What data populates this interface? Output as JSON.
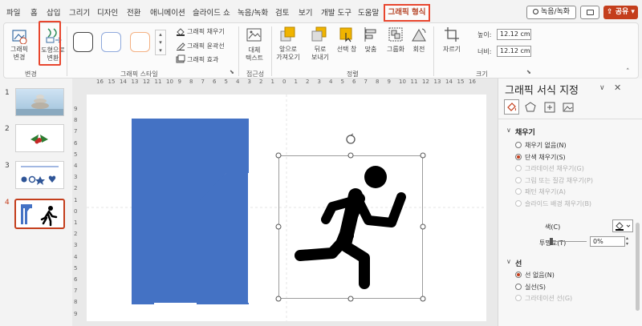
{
  "menu": {
    "items": [
      "파일",
      "홈",
      "삽입",
      "그리기",
      "디자인",
      "전환",
      "애니메이션",
      "슬라이드 쇼",
      "녹음/녹화",
      "검토",
      "보기",
      "개발 도구",
      "도움말"
    ],
    "active_tab": "그래픽 형식",
    "record_button": "녹음/녹화",
    "share_button": "공유"
  },
  "ribbon": {
    "change_graphic": "그래픽\n변경",
    "convert_shape_1": "도형으로",
    "convert_shape_2": "변환",
    "group_change": "변경",
    "graphic_fill": "그래픽 채우기",
    "graphic_outline": "그래픽 윤곽선",
    "graphic_effects": "그래픽 효과",
    "group_styles": "그래픽 스타일",
    "alt_text_1": "대체",
    "alt_text_2": "텍스트",
    "group_accessibility": "접근성",
    "bring_forward_1": "앞으로",
    "bring_forward_2": "가져오기",
    "send_backward_1": "뒤로",
    "send_backward_2": "보내기",
    "selection_pane": "선택 창",
    "align": "맞춤",
    "group": "그룹화",
    "rotate": "회전",
    "group_arrange": "정렬",
    "crop": "자르기",
    "height_label": "높이:",
    "height_value": "12.12 cm",
    "width_label": "너비:",
    "width_value": "12.12 cm",
    "group_size": "크기"
  },
  "slides": [
    {
      "number": "1",
      "desc": "stones"
    },
    {
      "number": "2",
      "desc": "holly"
    },
    {
      "number": "3",
      "desc": "shapes"
    },
    {
      "number": "4",
      "desc": "runner"
    }
  ],
  "ruler": {
    "h_ticks": [
      "16",
      "15",
      "14",
      "13",
      "12",
      "11",
      "10",
      "9",
      "8",
      "7",
      "6",
      "5",
      "4",
      "3",
      "2",
      "1",
      "0",
      "1",
      "2",
      "3",
      "4",
      "5",
      "6",
      "7",
      "8",
      "9",
      "10",
      "11",
      "12",
      "13",
      "14",
      "15",
      "16"
    ],
    "v_ticks": [
      "9",
      "8",
      "7",
      "6",
      "5",
      "4",
      "3",
      "2",
      "1",
      "0",
      "1",
      "2",
      "3",
      "4",
      "5",
      "6",
      "7",
      "8",
      "9"
    ]
  },
  "panel": {
    "title": "그래픽 서식 지정",
    "fill_section": "채우기",
    "fill_options": [
      {
        "label": "채우기 없음(N)",
        "selected": false,
        "disabled": false
      },
      {
        "label": "단색 채우기(S)",
        "selected": true,
        "disabled": false
      },
      {
        "label": "그라데이션 채우기(G)",
        "selected": false,
        "disabled": true
      },
      {
        "label": "그림 또는 질감 채우기(P)",
        "selected": false,
        "disabled": true
      },
      {
        "label": "패턴 채우기(A)",
        "selected": false,
        "disabled": true
      },
      {
        "label": "슬라이드 배경 채우기(B)",
        "selected": false,
        "disabled": true
      }
    ],
    "color_label": "색(C)",
    "transparency_label": "투명도(T)",
    "transparency_value": "0%",
    "line_section": "선",
    "line_options": [
      {
        "label": "선 없음(N)",
        "selected": true,
        "disabled": false
      },
      {
        "label": "실선(S)",
        "selected": false,
        "disabled": false
      },
      {
        "label": "그라데이션 선(G)",
        "selected": false,
        "disabled": true
      }
    ]
  },
  "colors": {
    "accent": "#c43e1c",
    "highlight": "#e8462e",
    "shape_blue": "#4472c4",
    "style_box_blue": "#8fa9dc",
    "style_box_orange": "#f4b183"
  }
}
